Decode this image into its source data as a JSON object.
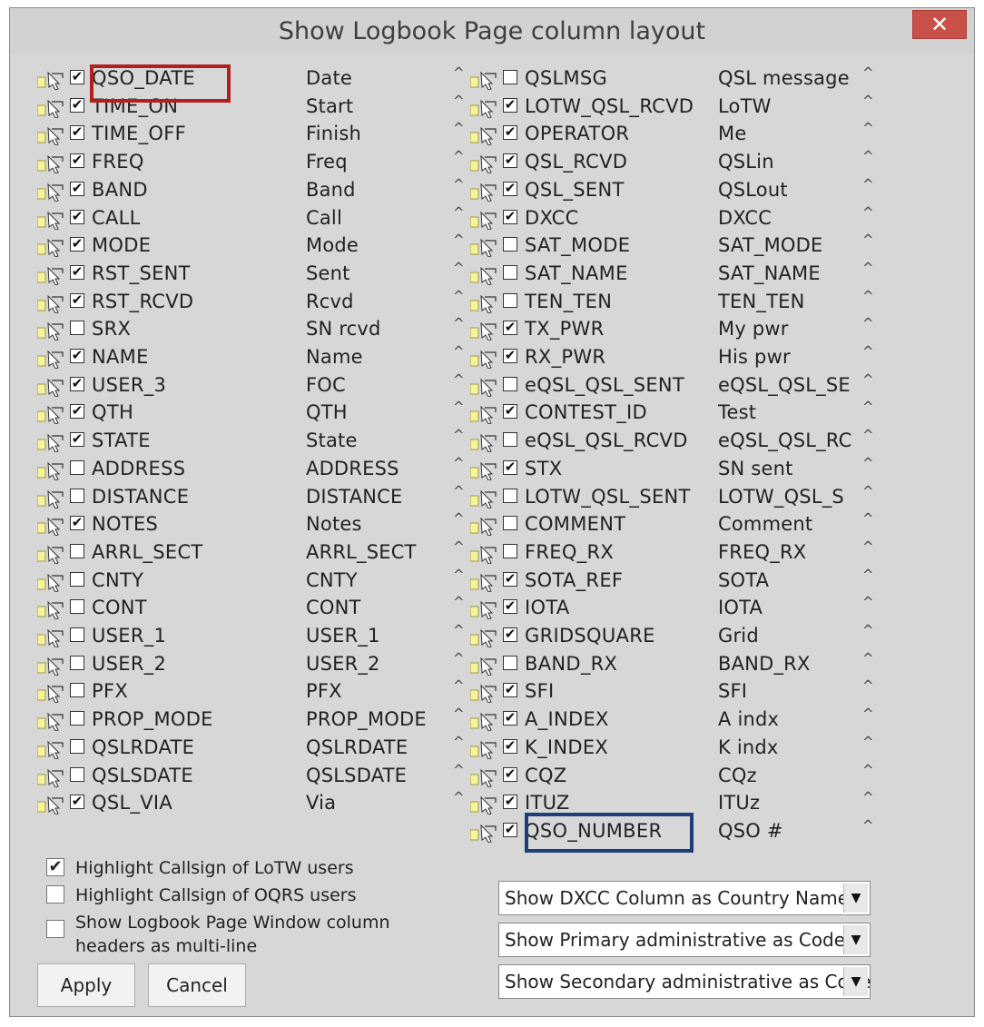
{
  "window": {
    "title": "Show Logbook Page column layout",
    "close_label": "✕"
  },
  "left_fields": [
    {
      "name": "QSO_DATE",
      "header": "Date",
      "checked": true,
      "caret": "^"
    },
    {
      "name": "TIME_ON",
      "header": "Start",
      "checked": true,
      "caret": "^"
    },
    {
      "name": "TIME_OFF",
      "header": "Finish",
      "checked": true,
      "caret": "^"
    },
    {
      "name": "FREQ",
      "header": "Freq",
      "checked": true,
      "caret": "^"
    },
    {
      "name": "BAND",
      "header": "Band",
      "checked": true,
      "caret": "^"
    },
    {
      "name": "CALL",
      "header": "Call",
      "checked": true,
      "caret": "^"
    },
    {
      "name": "MODE",
      "header": "Mode",
      "checked": true,
      "caret": "^"
    },
    {
      "name": "RST_SENT",
      "header": "Sent",
      "checked": true,
      "caret": "^"
    },
    {
      "name": "RST_RCVD",
      "header": "Rcvd",
      "checked": true,
      "caret": "^"
    },
    {
      "name": "SRX",
      "header": "SN rcvd",
      "checked": false,
      "caret": "^"
    },
    {
      "name": "NAME",
      "header": "Name",
      "checked": true,
      "caret": "^"
    },
    {
      "name": "USER_3",
      "header": "FOC",
      "checked": true,
      "caret": "^"
    },
    {
      "name": "QTH",
      "header": "QTH",
      "checked": true,
      "caret": "^"
    },
    {
      "name": "STATE",
      "header": "State",
      "checked": true,
      "caret": "^"
    },
    {
      "name": "ADDRESS",
      "header": "ADDRESS",
      "checked": false,
      "caret": "^"
    },
    {
      "name": "DISTANCE",
      "header": "DISTANCE",
      "checked": false,
      "caret": "^"
    },
    {
      "name": "NOTES",
      "header": "Notes",
      "checked": true,
      "caret": "^"
    },
    {
      "name": "ARRL_SECT",
      "header": "ARRL_SECT",
      "checked": false,
      "caret": "^"
    },
    {
      "name": "CNTY",
      "header": "CNTY",
      "checked": false,
      "caret": "^"
    },
    {
      "name": "CONT",
      "header": "CONT",
      "checked": false,
      "caret": "^"
    },
    {
      "name": "USER_1",
      "header": "USER_1",
      "checked": false,
      "caret": "^"
    },
    {
      "name": "USER_2",
      "header": "USER_2",
      "checked": false,
      "caret": "^"
    },
    {
      "name": "PFX",
      "header": "PFX",
      "checked": false,
      "caret": "^"
    },
    {
      "name": "PROP_MODE",
      "header": "PROP_MODE",
      "checked": false,
      "caret": "^"
    },
    {
      "name": "QSLRDATE",
      "header": "QSLRDATE",
      "checked": false,
      "caret": "^"
    },
    {
      "name": "QSLSDATE",
      "header": "QSLSDATE",
      "checked": false,
      "caret": "^"
    },
    {
      "name": "QSL_VIA",
      "header": "Via",
      "checked": true,
      "caret": "^"
    }
  ],
  "right_fields": [
    {
      "name": "QSLMSG",
      "header": "QSL message",
      "checked": false,
      "caret": "^"
    },
    {
      "name": "LOTW_QSL_RCVD",
      "header": "LoTW",
      "checked": true,
      "caret": "^"
    },
    {
      "name": "OPERATOR",
      "header": "Me",
      "checked": true,
      "caret": "^"
    },
    {
      "name": "QSL_RCVD",
      "header": "QSLin",
      "checked": true,
      "caret": "^"
    },
    {
      "name": "QSL_SENT",
      "header": "QSLout",
      "checked": true,
      "caret": "^"
    },
    {
      "name": "DXCC",
      "header": "DXCC",
      "checked": true,
      "caret": "^"
    },
    {
      "name": "SAT_MODE",
      "header": "SAT_MODE",
      "checked": false,
      "caret": "^"
    },
    {
      "name": "SAT_NAME",
      "header": "SAT_NAME",
      "checked": false,
      "caret": "^"
    },
    {
      "name": "TEN_TEN",
      "header": "TEN_TEN",
      "checked": false,
      "caret": "^"
    },
    {
      "name": "TX_PWR",
      "header": "My pwr",
      "checked": true,
      "caret": "^"
    },
    {
      "name": "RX_PWR",
      "header": "His pwr",
      "checked": true,
      "caret": "^"
    },
    {
      "name": "eQSL_QSL_SENT",
      "header": "eQSL_QSL_SE",
      "checked": false,
      "caret": "^"
    },
    {
      "name": "CONTEST_ID",
      "header": "Test",
      "checked": true,
      "caret": "^"
    },
    {
      "name": "eQSL_QSL_RCVD",
      "header": "eQSL_QSL_RC",
      "checked": false,
      "caret": "^"
    },
    {
      "name": "STX",
      "header": "SN sent",
      "checked": true,
      "caret": "^"
    },
    {
      "name": "LOTW_QSL_SENT",
      "header": "LOTW_QSL_S",
      "checked": false,
      "caret": "^"
    },
    {
      "name": "COMMENT",
      "header": "Comment",
      "checked": false,
      "caret": "^"
    },
    {
      "name": "FREQ_RX",
      "header": "FREQ_RX",
      "checked": false,
      "caret": "^"
    },
    {
      "name": "SOTA_REF",
      "header": "SOTA",
      "checked": true,
      "caret": "^"
    },
    {
      "name": "IOTA",
      "header": "IOTA",
      "checked": true,
      "caret": "^"
    },
    {
      "name": "GRIDSQUARE",
      "header": "Grid",
      "checked": true,
      "caret": "^"
    },
    {
      "name": "BAND_RX",
      "header": "BAND_RX",
      "checked": false,
      "caret": "^"
    },
    {
      "name": "SFI",
      "header": "SFI",
      "checked": true,
      "caret": "^"
    },
    {
      "name": "A_INDEX",
      "header": "A indx",
      "checked": true,
      "caret": "^"
    },
    {
      "name": "K_INDEX",
      "header": "K indx",
      "checked": true,
      "caret": "^"
    },
    {
      "name": "CQZ",
      "header": "CQz",
      "checked": true,
      "caret": "^"
    },
    {
      "name": "ITUZ",
      "header": "ITUz",
      "checked": true,
      "caret": "^"
    },
    {
      "name": "QSO_NUMBER",
      "header": "QSO #",
      "checked": true,
      "caret": "^"
    }
  ],
  "options": [
    {
      "label": "Highlight Callsign of LoTW users",
      "checked": true
    },
    {
      "label": "Highlight Callsign of OQRS users",
      "checked": false
    },
    {
      "label": "Show Logbook Page Window column",
      "label2": "headers as multi-line",
      "checked": false
    }
  ],
  "buttons": {
    "apply": "Apply",
    "cancel": "Cancel"
  },
  "dropdowns": [
    {
      "value": "Show DXCC Column as Country Name"
    },
    {
      "value": "Show Primary administrative as Code"
    },
    {
      "value": "Show Secondary administrative as Code"
    }
  ],
  "colors": {
    "red_highlight": "#b21f1f",
    "blue_highlight": "#1d3e7a",
    "dialog_bg": "#d7d7d7"
  }
}
